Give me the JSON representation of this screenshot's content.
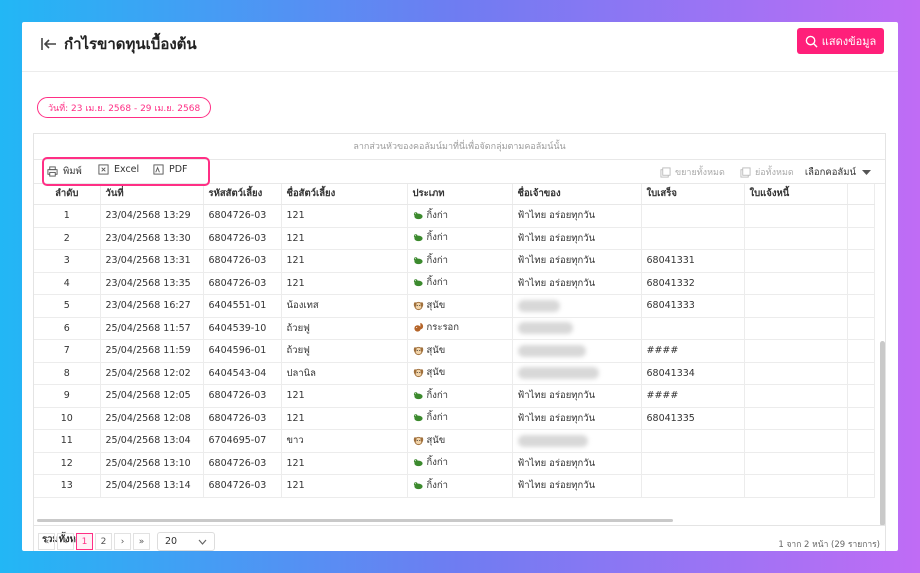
{
  "header": {
    "title": "กำไรขาดทุนเบื้องต้น",
    "show_label": "แสดงข้อมูล"
  },
  "filter": {
    "date_range": "วันที่: 23 เม.ย. 2568 - 29 เม.ย. 2568"
  },
  "grid": {
    "group_hint": "ลากส่วนหัวของคอลัมน์มาที่นี่เพื่อจัดกลุ่มตามคอลัมน์นั้น",
    "toolbar": {
      "print": "พิมพ์",
      "excel": "Excel",
      "pdf": "PDF",
      "expand_all": "ขยายทั้งหมด",
      "collapse_all": "ย่อทั้งหมด",
      "column_chooser": "เลือกคอลัมน์"
    },
    "columns": [
      "ลำดับ",
      "วันที่",
      "รหัสสัตว์เลี้ยง",
      "ชื่อสัตว์เลี้ยง",
      "ประเภท",
      "ชื่อเจ้าของ",
      "ใบเสร็จ",
      "ใบแจ้งหนี้"
    ],
    "rows": [
      {
        "no": "1",
        "date": "23/04/2568 13:29",
        "pet_id": "6804726-03",
        "pet_name": "121",
        "type": "กิ้งก่า",
        "type_icon": "lizard-icon",
        "owner": "ฟ้าไทย อร่อยทุกวัน",
        "owner_hidden": false,
        "receipt": "",
        "invoice": ""
      },
      {
        "no": "2",
        "date": "23/04/2568 13:30",
        "pet_id": "6804726-03",
        "pet_name": "121",
        "type": "กิ้งก่า",
        "type_icon": "lizard-icon",
        "owner": "ฟ้าไทย อร่อยทุกวัน",
        "owner_hidden": false,
        "receipt": "",
        "invoice": ""
      },
      {
        "no": "3",
        "date": "23/04/2568 13:31",
        "pet_id": "6804726-03",
        "pet_name": "121",
        "type": "กิ้งก่า",
        "type_icon": "lizard-icon",
        "owner": "ฟ้าไทย อร่อยทุกวัน",
        "owner_hidden": false,
        "receipt": "68041331",
        "invoice": ""
      },
      {
        "no": "4",
        "date": "23/04/2568 13:35",
        "pet_id": "6804726-03",
        "pet_name": "121",
        "type": "กิ้งก่า",
        "type_icon": "lizard-icon",
        "owner": "ฟ้าไทย อร่อยทุกวัน",
        "owner_hidden": false,
        "receipt": "68041332",
        "invoice": ""
      },
      {
        "no": "5",
        "date": "23/04/2568 16:27",
        "pet_id": "6404551-01",
        "pet_name": "น้องเทส",
        "type": "สุนัข",
        "type_icon": "dog-icon",
        "owner": "",
        "owner_hidden": true,
        "receipt": "68041333",
        "invoice": ""
      },
      {
        "no": "6",
        "date": "25/04/2568 11:57",
        "pet_id": "6404539-10",
        "pet_name": "ถ้วยฟู",
        "type": "กระรอก",
        "type_icon": "squirrel-icon",
        "owner": "",
        "owner_hidden": true,
        "receipt": "",
        "invoice": ""
      },
      {
        "no": "7",
        "date": "25/04/2568 11:59",
        "pet_id": "6404596-01",
        "pet_name": "ถ้วยฟู",
        "type": "สุนัข",
        "type_icon": "dog-icon",
        "owner": "",
        "owner_hidden": true,
        "receipt": "####",
        "invoice": ""
      },
      {
        "no": "8",
        "date": "25/04/2568 12:02",
        "pet_id": "6404543-04",
        "pet_name": "ปลานิล",
        "type": "สุนัข",
        "type_icon": "dog-icon",
        "owner": "",
        "owner_hidden": true,
        "receipt": "68041334",
        "invoice": ""
      },
      {
        "no": "9",
        "date": "25/04/2568 12:05",
        "pet_id": "6804726-03",
        "pet_name": "121",
        "type": "กิ้งก่า",
        "type_icon": "lizard-icon",
        "owner": "ฟ้าไทย อร่อยทุกวัน",
        "owner_hidden": false,
        "receipt": "####",
        "invoice": ""
      },
      {
        "no": "10",
        "date": "25/04/2568 12:08",
        "pet_id": "6804726-03",
        "pet_name": "121",
        "type": "กิ้งก่า",
        "type_icon": "lizard-icon",
        "owner": "ฟ้าไทย อร่อยทุกวัน",
        "owner_hidden": false,
        "receipt": "68041335",
        "invoice": ""
      },
      {
        "no": "11",
        "date": "25/04/2568 13:04",
        "pet_id": "6704695-07",
        "pet_name": "ขาว",
        "type": "สุนัข",
        "type_icon": "dog-icon",
        "owner": "",
        "owner_hidden": true,
        "receipt": "",
        "invoice": ""
      },
      {
        "no": "12",
        "date": "25/04/2568 13:10",
        "pet_id": "6804726-03",
        "pet_name": "121",
        "type": "กิ้งก่า",
        "type_icon": "lizard-icon",
        "owner": "ฟ้าไทย อร่อยทุกวัน",
        "owner_hidden": false,
        "receipt": "",
        "invoice": ""
      },
      {
        "no": "13",
        "date": "25/04/2568 13:14",
        "pet_id": "6804726-03",
        "pet_name": "121",
        "type": "กิ้งก่า",
        "type_icon": "lizard-icon",
        "owner": "ฟ้าไทย อร่อยทุกวัน",
        "owner_hidden": false,
        "receipt": "",
        "invoice": ""
      }
    ],
    "summary_label": "รวมทั้งหมด"
  },
  "pager": {
    "first": "«",
    "prev": "‹",
    "pages": [
      "1",
      "2"
    ],
    "active_page": "1",
    "next": "›",
    "last": "»",
    "page_size": "20",
    "info": "1 จาก 2 หน้า (29 รายการ)"
  },
  "colors": {
    "accent": "#ff1f7a",
    "lizard": "#3c8a2e",
    "dog": "#a0703c",
    "squirrel": "#b5652a"
  }
}
